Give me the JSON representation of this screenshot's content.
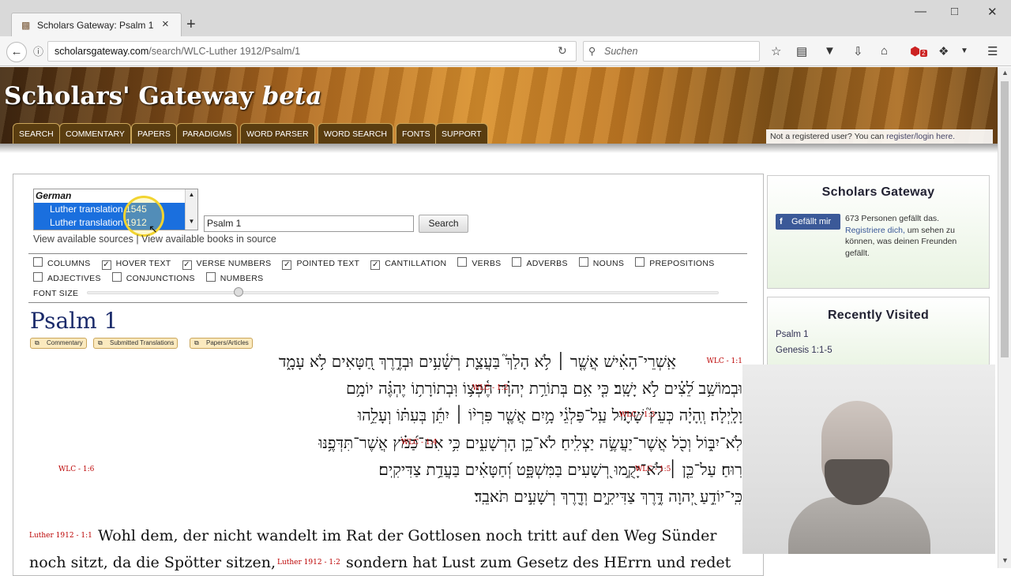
{
  "browser": {
    "tab_title": "Scholars Gateway: Psalm 1",
    "tab_favicon": "scroll-icon",
    "url_domain": "scholarsgateway.com",
    "url_path": "/search/WLC-Luther 1912/Psalm/1",
    "search_placeholder": "Suchen",
    "addon_badge": "2"
  },
  "header": {
    "site_title": "Scholars' Gateway",
    "site_title_suffix": "beta",
    "nav": [
      "SEARCH",
      "COMMENTARY",
      "PAPERS",
      "PARADIGMS",
      "WORD PARSER",
      "WORD SEARCH",
      "FONTS",
      "SUPPORT"
    ],
    "register_text": "Not a registered user? You can ",
    "register_link": "register/login here."
  },
  "search": {
    "group_label": "German",
    "selected_sources": [
      "Luther translation 1545",
      "Luther translation 1912"
    ],
    "reference_value": "Psalm 1",
    "search_button": "Search",
    "view_sources_link": "View available sources",
    "separator": "|",
    "view_books_link": "View available books in source"
  },
  "options": {
    "checkboxes": [
      {
        "label": "COLUMNS",
        "checked": false
      },
      {
        "label": "HOVER TEXT",
        "checked": true
      },
      {
        "label": "VERSE NUMBERS",
        "checked": true
      },
      {
        "label": "POINTED TEXT",
        "checked": true
      },
      {
        "label": "CANTILLATION",
        "checked": true
      },
      {
        "label": "VERBS",
        "checked": false
      },
      {
        "label": "ADVERBS",
        "checked": false
      },
      {
        "label": "NOUNS",
        "checked": false
      },
      {
        "label": "PREPOSITIONS",
        "checked": false
      },
      {
        "label": "ADJECTIVES",
        "checked": false
      },
      {
        "label": "CONJUNCTIONS",
        "checked": false
      },
      {
        "label": "NUMBERS",
        "checked": false
      }
    ],
    "font_size_label": "FONT SIZE",
    "font_size_level": 0.24
  },
  "passage": {
    "title": "Psalm 1",
    "buttons": [
      "Commentary",
      "Submitted Translations",
      "Papers/Articles"
    ],
    "hebrew_lines": [
      {
        "text": "אַֽשְׁרֵי־הָאִ֗ישׁ אֲשֶׁ֤ר ׀ לֹ֥א הָלַךְ֮ בַּעֲצַ֪ת רְשָׁ֫עִ֥ים וּבְדֶ֣רֶךְ חַ֭טָּאִים לֹ֥א עָמָ֑ד",
        "tags": [
          "WLC - 1:1"
        ]
      },
      {
        "text": "וּבְמוֹשַׁ֥ב לֵ֝צִ֗ים לֹ֣א יָשָֽׁב׃ כִּ֤י אִ֥ם בְּתוֹרַ֥ת יְהוָ֗ה חֶ֫פְצ֥וֹ וּֽבְתוֹרָת֥וֹ יֶהְגֶּ֗ה יוֹמָ֥ם",
        "tags": [
          "WLC - 1:2"
        ]
      },
      {
        "text": "וָלָֽיְלָה׃ וְֽהָיָ֗ה כְּעֵץ֮ שָׁת֪וּל עַֽל־פַּלְגֵ֫י מָ֥יִם אֲשֶׁ֤ר פִּרְי֨וֹ ׀ יִתֵּ֬ן בְּעִתּ֗וֹ וְעָלֵ֥הוּ",
        "tags": [
          "WLC - 1:3"
        ]
      },
      {
        "text": "לֹֽא־יִבּ֑וֹל וְכֹ֖ל אֲשֶׁר־יַעֲשֶׂ֣ה יַצְלִֽיחַ׃ לֹא־כֵ֥ן הָרְשָׁעִ֑ים כִּ֥י אִם־כַּ֝מֹּ֗ץ אֲשֶׁר־תִּדְּפֶ֥נּוּ",
        "tags": [
          "WLC - 1:4"
        ]
      },
      {
        "text": "רֽוּחַ׃ עַל־כֵּ֤ן ׀ לֹא־יָקֻ֣מוּ רְ֭שָׁעִים בַּמִּשְׁפָּ֑ט וְ֝חַטָּאִ֗ים בַּעֲדַ֥ת צַדִּיקִֽים׃",
        "tags": [
          "WLC - 1:5",
          "WLC - 1:6"
        ]
      },
      {
        "text": "כִּֽי־יוֹדֵ֣עַ יְ֭הוָה דֶּ֣רֶךְ צַדִּיקִ֑ים וְדֶ֖רֶךְ רְשָׁעִ֣ים תֹּאבֵֽד׃",
        "tags": []
      }
    ],
    "german_tag_1": "Luther 1912 - 1:1",
    "german_line_1": "Wohl dem, der nicht wandelt im Rat der Gottlosen noch tritt auf den Weg Sünder",
    "german_line_2a": "noch sitzt, da die Spötter sitzen,",
    "german_tag_2": "Luther 1912 - 1:2",
    "german_line_2b": "sondern hat Lust zum Gesetz des HErrn und redet"
  },
  "sidebar": {
    "title": "Scholars Gateway",
    "fb_button": "Gefällt mir",
    "fb_count_text": "673 Personen gefällt das.",
    "fb_register_link": "Registriere dich,",
    "fb_rest": " um sehen zu können, was deinen Freunden gefällt.",
    "recent_title": "Recently Visited",
    "recent_items": [
      "Psalm 1",
      "Genesis 1:1-5"
    ]
  },
  "colors": {
    "nav_tab_bg": "#5a3d10",
    "selection_blue": "#1a6fde",
    "verse_tag_red": "#bb0000",
    "facebook_blue": "#3b5998"
  }
}
